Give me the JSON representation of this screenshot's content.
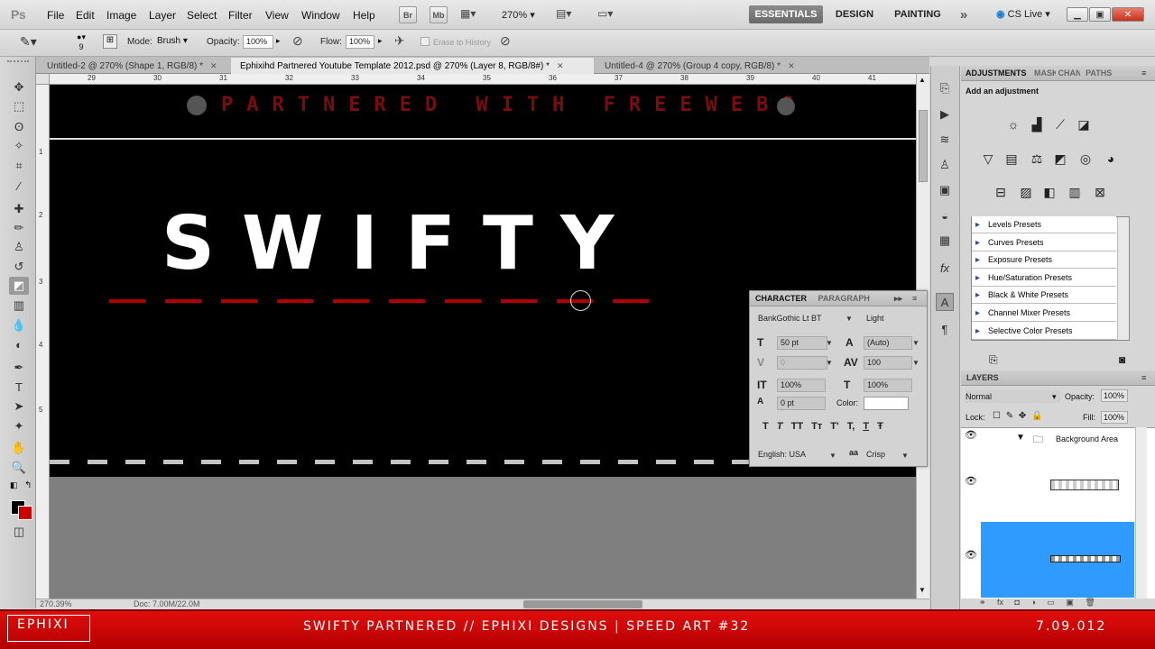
{
  "app": {
    "logo": "Ps"
  },
  "menu": [
    "File",
    "Edit",
    "Image",
    "Layer",
    "Select",
    "Filter",
    "View",
    "Window",
    "Help"
  ],
  "menubar": {
    "bridge_btn": "Br",
    "minibridge_btn": "Mb",
    "zoom": "270%",
    "workspaces": [
      "ESSENTIALS",
      "DESIGN",
      "PAINTING"
    ],
    "overflow": "»",
    "cs_live": "CS Live"
  },
  "options": {
    "brush_size": "9",
    "mode_label": "Mode:",
    "mode_value": "Brush",
    "opacity_label": "Opacity:",
    "opacity_value": "100%",
    "flow_label": "Flow:",
    "flow_value": "100%",
    "erase_history": "Erase to History"
  },
  "tabs": [
    {
      "label": "Untitled-2 @ 270% (Shape 1, RGB/8) *"
    },
    {
      "label": "Ephixihd Partnered Youtube Template 2012.psd @ 270% (Layer 8, RGB/8#) *"
    },
    {
      "label": "Untitled-4 @ 270% (Group 4 copy, RGB/8) *"
    }
  ],
  "ruler": {
    "h_ticks": [
      "29",
      "30",
      "31",
      "32",
      "33",
      "34",
      "35",
      "36",
      "37",
      "38",
      "39",
      "40",
      "41"
    ],
    "v_ticks": [
      "1",
      "2",
      "3",
      "4",
      "5"
    ]
  },
  "canvas": {
    "partnered_text": "PARTNERED WITH FREEWEBS",
    "title": "SWIFTY"
  },
  "status": {
    "zoom": "270.39%",
    "doc": "Doc: 7.00M/22.0M"
  },
  "adjustments": {
    "tabs": [
      "ADJUSTMENTS",
      "MASKS",
      "CHANNELS",
      "PATHS"
    ],
    "subtitle": "Add an adjustment",
    "presets": [
      "Levels Presets",
      "Curves Presets",
      "Exposure Presets",
      "Hue/Saturation Presets",
      "Black & White Presets",
      "Channel Mixer Presets",
      "Selective Color Presets"
    ]
  },
  "character": {
    "tabs": [
      "CHARACTER",
      "PARAGRAPH"
    ],
    "font_family": "BankGothic Lt BT",
    "font_style": "Light",
    "font_size": "50 pt",
    "leading": "(Auto)",
    "kerning": "0",
    "tracking": "100",
    "vscale": "100%",
    "hscale": "100%",
    "baseline": "0 pt",
    "color_label": "Color:",
    "language": "English: USA",
    "aa_label": "a",
    "antialias": "Crisp",
    "style_buttons": [
      "T",
      "T",
      "TT",
      "Tт",
      "T'",
      "T,",
      "T",
      "Ŧ"
    ]
  },
  "layers": {
    "title": "LAYERS",
    "blend": "Normal",
    "opacity_label": "Opacity:",
    "opacity_value": "100%",
    "lock_label": "Lock:",
    "fill_label": "Fill:",
    "fill_value": "100%",
    "group_name": "Background Area"
  },
  "banner": {
    "logo": "EPHIXI",
    "text": "SWIFTY PARTNERED // EPHIXI DESIGNS | SPEED ART #32",
    "date": "7.09.012"
  },
  "colors": {
    "accent_red": "#cc0000",
    "layer_selected": "#2f9bff",
    "canvas_bg": "#000000"
  }
}
